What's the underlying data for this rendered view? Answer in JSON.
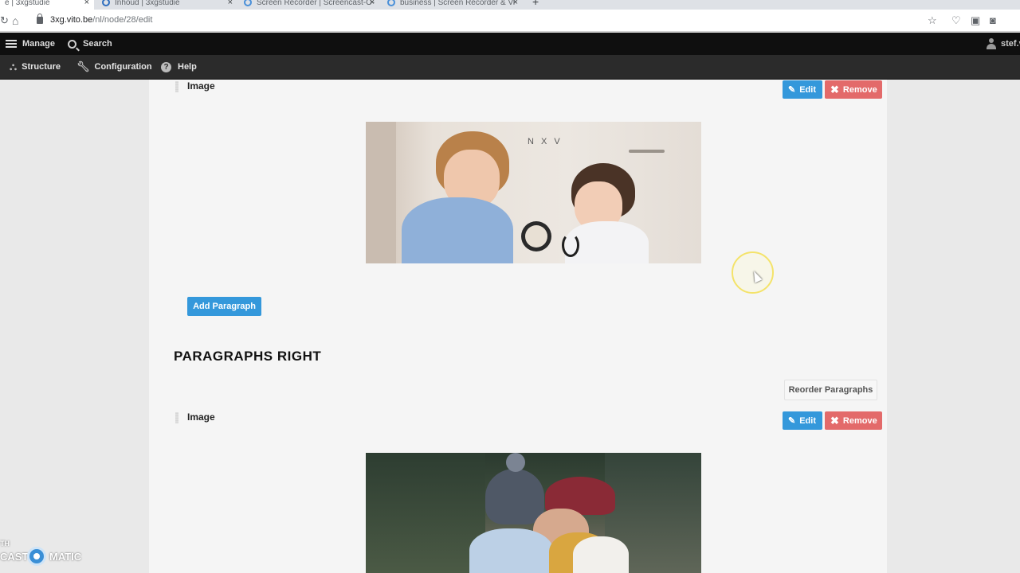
{
  "browser": {
    "tabs": [
      {
        "title": "e | 3xgstudie",
        "active": true
      },
      {
        "title": "Inhoud | 3xgstudie",
        "active": false
      },
      {
        "title": "Screen Recorder | Screencast-O-",
        "active": false
      },
      {
        "title": "business | Screen Recorder & Vi",
        "active": false
      }
    ],
    "close_glyph": "×",
    "new_tab_glyph": "+",
    "url_host": "3xg.vito.be",
    "url_path": "/nl/node/28/edit"
  },
  "toolbar": {
    "manage": "Manage",
    "search": "Search",
    "user": "stef.v",
    "structure": "Structure",
    "configuration": "Configuration",
    "help": "Help"
  },
  "content": {
    "paragraph1": {
      "label": "Image",
      "edit": "Edit",
      "remove": "Remove"
    },
    "add_paragraph": "Add Paragraph",
    "section_title": "PARAGRAPHS RIGHT",
    "reorder": "Reorder Paragraphs",
    "paragraph2": {
      "label": "Image",
      "edit": "Edit",
      "remove": "Remove"
    },
    "photo1_sign": "N X V"
  },
  "watermark": {
    "small": "TH",
    "left": "CAST",
    "right": "MATIC"
  },
  "colors": {
    "edit_button": "#3498db",
    "remove_button": "#e36a6a",
    "toolbar_dark": "#0f0f0f",
    "toolbar_secondary": "#2b2b2b"
  }
}
